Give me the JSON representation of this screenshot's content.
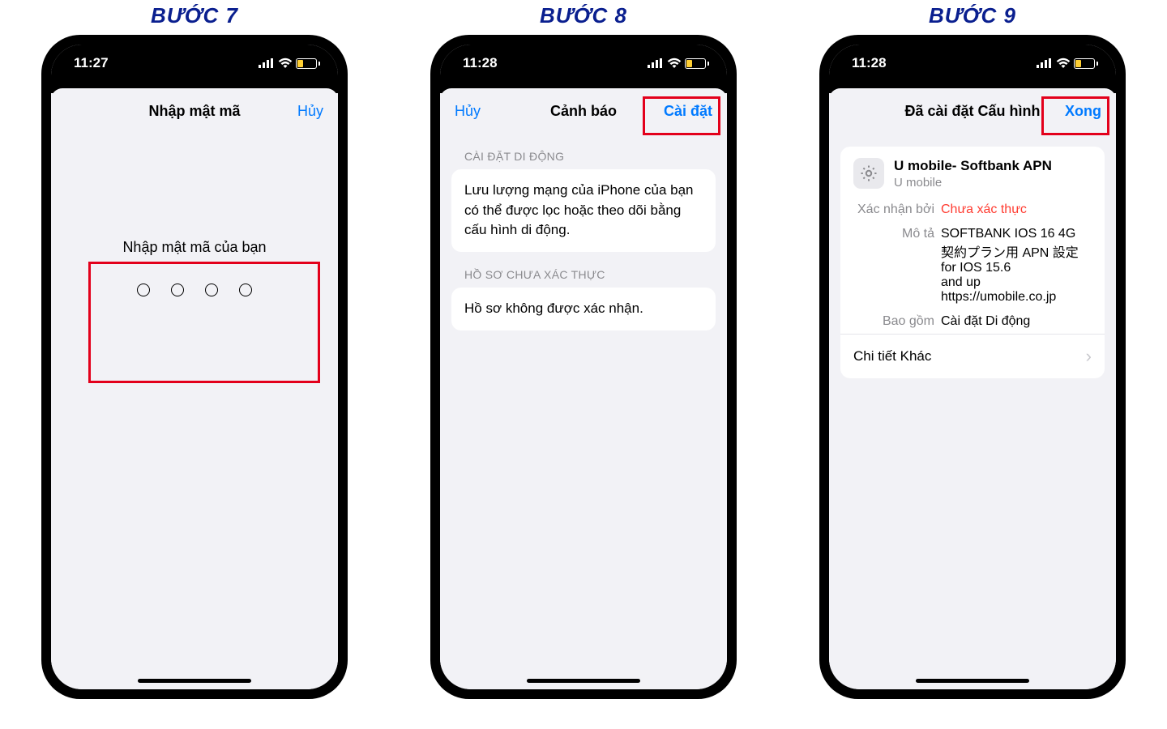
{
  "steps": {
    "s7": {
      "label": "BƯỚC 7"
    },
    "s8": {
      "label": "BƯỚC 8"
    },
    "s9": {
      "label": "BƯỚC 9"
    }
  },
  "status": {
    "t7": "11:27",
    "t8": "11:28",
    "t9": "11:28"
  },
  "step7": {
    "nav_title": "Nhập mật mã",
    "cancel": "Hủy",
    "prompt": "Nhập mật mã của bạn"
  },
  "step8": {
    "cancel": "Hủy",
    "nav_title": "Cảnh báo",
    "install": "Cài đặt",
    "group1_header": "CÀI ĐẶT DI ĐỘNG",
    "group1_body": "Lưu lượng mạng của iPhone của bạn có thể được lọc hoặc theo dõi bằng cấu hình di động.",
    "group2_header": "HỒ SƠ CHƯA XÁC THỰC",
    "group2_body": "Hồ sơ không được xác nhận."
  },
  "step9": {
    "nav_title": "Đã cài đặt Cấu hình",
    "done": "Xong",
    "profile_title": "U mobile- Softbank APN",
    "profile_sub": "U mobile",
    "k_signed": "Xác nhận bởi",
    "v_signed": "Chưa xác thực",
    "k_desc": "Mô tả",
    "v_desc": "SOFTBANK IOS 16 4G 契約プラン用 APN 設定\n                         for IOS 15.6\nand up\nhttps://umobile.co.jp",
    "k_contains": "Bao gồm",
    "v_contains": "Cài đặt Di động",
    "more": "Chi tiết Khác"
  }
}
